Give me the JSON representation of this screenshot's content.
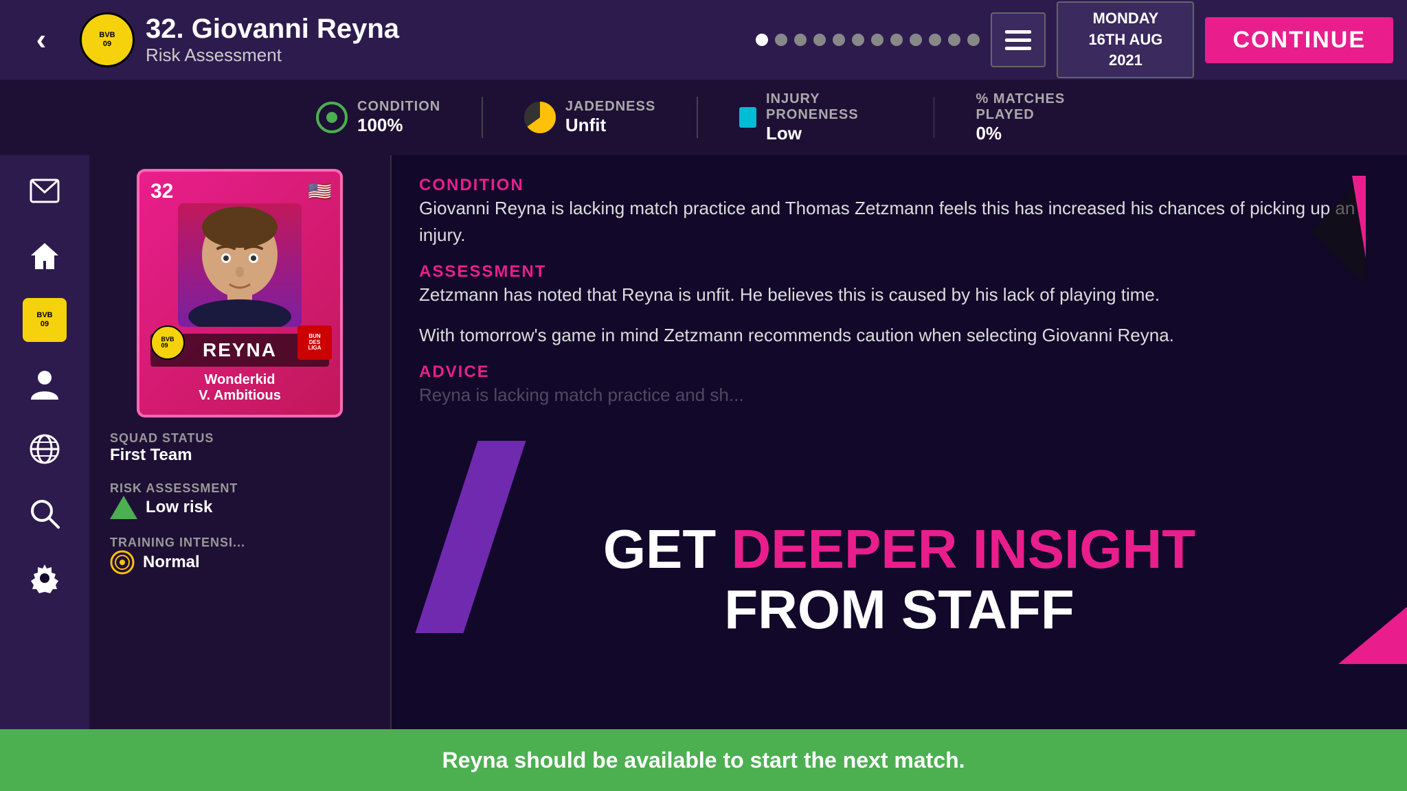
{
  "topbar": {
    "back_label": "‹",
    "club_logo": "BVB\n09",
    "player_number": "32.",
    "player_name": "Giovanni Reyna",
    "section": "Risk Assessment",
    "date_line1": "MONDAY",
    "date_line2": "16TH AUG",
    "date_line3": "2021",
    "continue_label": "CONTINUE",
    "dots": [
      true,
      false,
      false,
      false,
      false,
      false,
      false,
      false,
      false,
      false,
      false,
      false
    ]
  },
  "stats": {
    "condition_label": "CONDITION",
    "condition_value": "100%",
    "jadedness_label": "JADEDNESS",
    "jadedness_value": "Unfit",
    "injury_label": "INJURY PRONENESS",
    "injury_value": "Low",
    "matches_label": "% MATCHES PLAYED",
    "matches_value": "0%"
  },
  "sidebar": {
    "icons": [
      "mail",
      "home",
      "bvb",
      "person",
      "globe",
      "search",
      "settings"
    ]
  },
  "player": {
    "card_number": "32",
    "card_flag": "🇺🇸",
    "card_name": "REYNA",
    "card_attr1": "Wonderkid",
    "card_attr2": "V. Ambitious",
    "squad_status_label": "SQUAD STATUS",
    "squad_status_value": "First Team",
    "risk_label": "RISK ASSESSMENT",
    "risk_value": "Low risk",
    "training_label": "TRAINING INTENSI...",
    "training_value": "Normal"
  },
  "main": {
    "condition_label": "CONDITION",
    "condition_text": "Giovanni Reyna is lacking match practice and Thomas Zetzmann feels this has increased his chances of picking up an injury.",
    "assessment_label": "ASSESSMENT",
    "assessment_text": "Zetzmann has noted that Reyna is unfit. He believes this is caused by his lack of playing time.",
    "caution_text": "With tomorrow's game in mind Zetzmann recommends caution when selecting Giovanni Reyna.",
    "advice_label": "ADVICE",
    "advice_text": "Reyna is lacking match practice and sh...",
    "promo_line1a": "GET ",
    "promo_line1b": "DEEPER INSIGHT",
    "promo_line2": "FROM STAFF",
    "bottom_message": "Reyna should be available to start the next match."
  }
}
